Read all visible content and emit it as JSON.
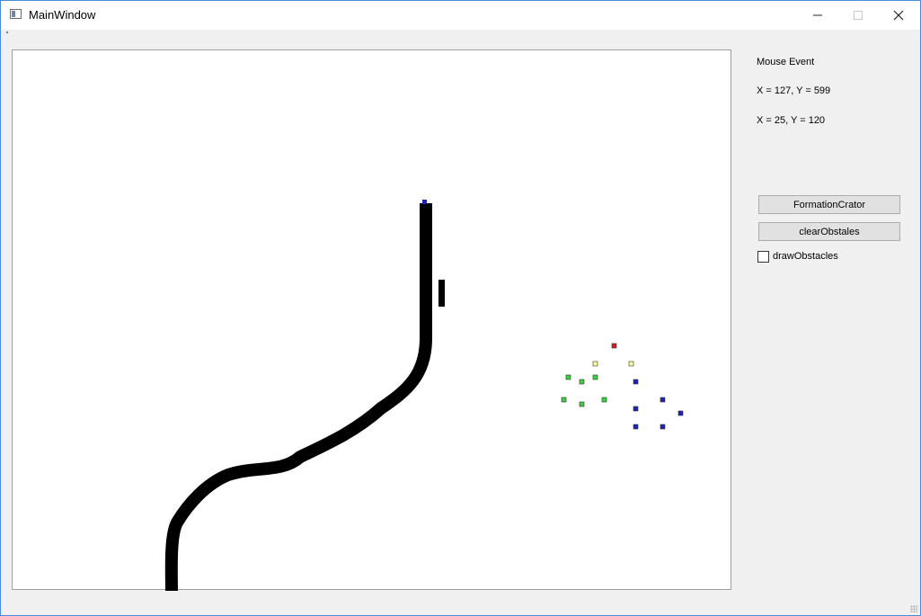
{
  "window": {
    "title": "MainWindow"
  },
  "controls": {
    "minimize_glyph": "—",
    "maximize_glyph": "☐",
    "close_glyph": "✕"
  },
  "panel": {
    "header": "Mouse Event",
    "coord1": "X = 127, Y = 599",
    "coord2": "X = 25, Y = 120",
    "formation_button": "FormationCrator",
    "clear_button": "clearObstales",
    "draw_checkbox_label": "drawObstacles",
    "draw_checkbox_checked": false
  },
  "canvas": {
    "obstacle_color": "#000000",
    "agent_colors": {
      "leader": "#d42020",
      "yellow": "#fbffa0",
      "green": "#3bd23b",
      "blue": "#1a22b8"
    },
    "icons": [
      "app-icon",
      "size-grip-icon"
    ]
  }
}
